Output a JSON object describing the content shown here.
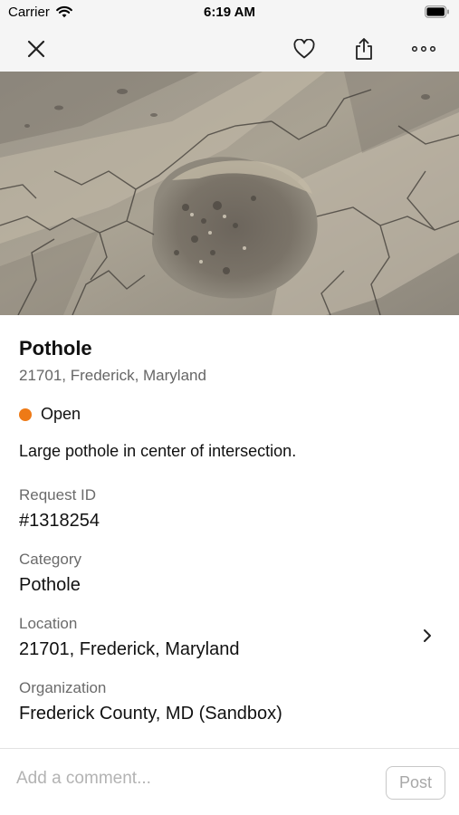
{
  "status_bar": {
    "carrier": "Carrier",
    "time": "6:19 AM"
  },
  "nav": {
    "icons": [
      "close-icon",
      "heart-icon",
      "share-icon",
      "more-icon"
    ]
  },
  "request": {
    "title": "Pothole",
    "address": "21701, Frederick, Maryland",
    "status": "Open",
    "status_color": "#ee7a16",
    "description": "Large pothole in center of intersection."
  },
  "fields": {
    "request_id": {
      "label": "Request ID",
      "value": "#1318254"
    },
    "category": {
      "label": "Category",
      "value": "Pothole"
    },
    "location": {
      "label": "Location",
      "value": "21701, Frederick, Maryland"
    },
    "organization": {
      "label": "Organization",
      "value": "Frederick County, MD (Sandbox)"
    }
  },
  "comment": {
    "placeholder": "Add a comment...",
    "post_label": "Post"
  }
}
